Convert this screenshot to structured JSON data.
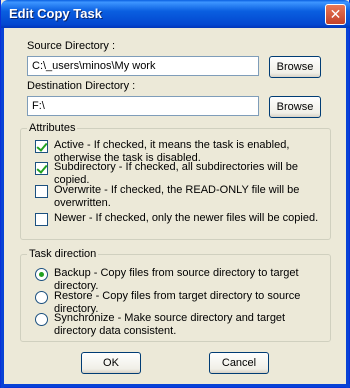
{
  "window": {
    "title": "Edit Copy Task",
    "close_icon": "✕"
  },
  "source": {
    "label": "Source Directory :",
    "value": "C:\\_users\\minos\\My work",
    "browse_label": "Browse"
  },
  "destination": {
    "label": "Destination Directory :",
    "value": "F:\\",
    "browse_label": "Browse"
  },
  "attributes": {
    "title": "Attributes",
    "items": [
      {
        "checked": true,
        "text": "Active - If checked, it means the task is enabled, otherwise the task is disabled."
      },
      {
        "checked": true,
        "text": "Subdirectory - If checked, all subdirectories will be copied."
      },
      {
        "checked": false,
        "text": "Overwrite - If checked, the READ-ONLY file will be overwritten."
      },
      {
        "checked": false,
        "text": "Newer - If checked, only the newer files will be copied."
      }
    ]
  },
  "direction": {
    "title": "Task direction",
    "items": [
      {
        "selected": true,
        "text": "Backup - Copy files from source directory to target directory."
      },
      {
        "selected": false,
        "text": "Restore - Copy files from target directory to source directory."
      },
      {
        "selected": false,
        "text": "Synchronize - Make source directory and target directory data consistent."
      }
    ]
  },
  "buttons": {
    "ok": "OK",
    "cancel": "Cancel"
  },
  "colors": {
    "titlebar": "#0a5fe0",
    "window_bg": "#ece9d8",
    "check": "#21a121"
  }
}
